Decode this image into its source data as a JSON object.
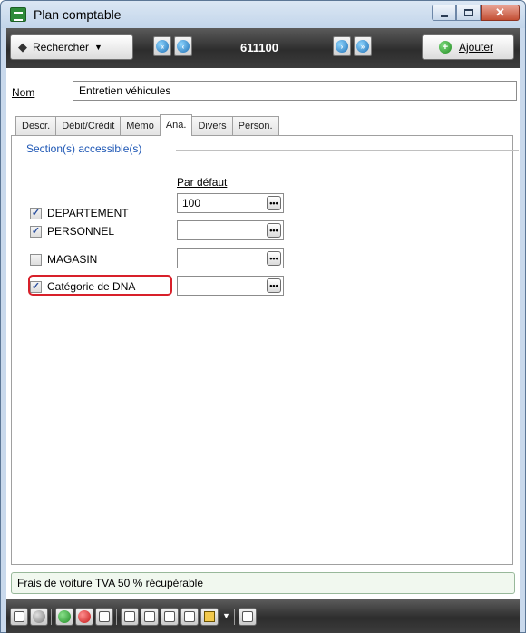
{
  "window": {
    "title": "Plan comptable",
    "accent": "#1e57b5",
    "highlight_color": "#d8202a"
  },
  "toolbar": {
    "search_label": "Rechercher",
    "account_code": "611100",
    "add_label": "Ajouter"
  },
  "form": {
    "nom_label": "Nom",
    "nom_value": "Entretien véhicules"
  },
  "tabs": [
    {
      "label": "Descr."
    },
    {
      "label": "Débit/Crédit"
    },
    {
      "label": "Mémo"
    },
    {
      "label": "Ana.",
      "active": true
    },
    {
      "label": "Divers"
    },
    {
      "label": "Person."
    }
  ],
  "analytics": {
    "section_title": "Section(s) accessible(s)",
    "column_header": "Par défaut",
    "rows": [
      {
        "label": "DEPARTEMENT",
        "checked": true,
        "default": "100"
      },
      {
        "label": "PERSONNEL",
        "checked": true,
        "default": ""
      },
      {
        "label": "MAGASIN",
        "checked": false,
        "default": ""
      },
      {
        "label": "Catégorie de DNA",
        "checked": true,
        "default": ""
      }
    ]
  },
  "status": {
    "text": "Frais de voiture TVA 50 % récupérable"
  }
}
